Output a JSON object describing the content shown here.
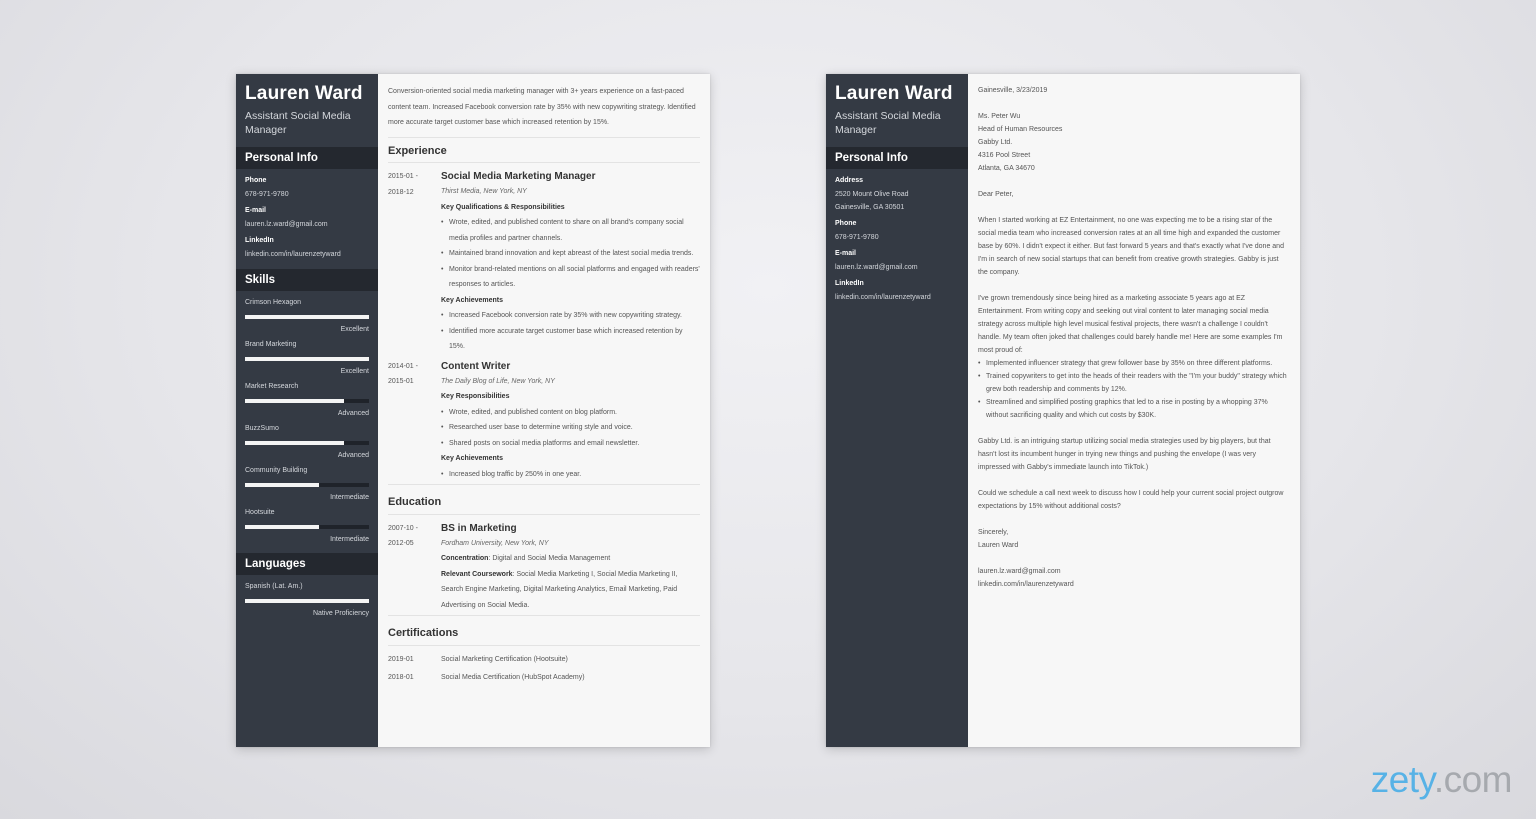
{
  "resume": {
    "name": "Lauren Ward",
    "role": "Assistant Social Media Manager",
    "personal_info_heading": "Personal Info",
    "personal_info": [
      {
        "label": "Phone",
        "value": "678-971-9780"
      },
      {
        "label": "E-mail",
        "value": "lauren.lz.ward@gmail.com"
      },
      {
        "label": "LinkedIn",
        "value": "linkedin.com/in/laurenzetyward"
      }
    ],
    "skills_heading": "Skills",
    "skills": [
      {
        "name": "Crimson Hexagon",
        "level": "Excellent",
        "fill": 1.0
      },
      {
        "name": "Brand Marketing",
        "level": "Excellent",
        "fill": 1.0
      },
      {
        "name": "Market Research",
        "level": "Advanced",
        "fill": 0.8
      },
      {
        "name": "BuzzSumo",
        "level": "Advanced",
        "fill": 0.8
      },
      {
        "name": "Community Building",
        "level": "Intermediate",
        "fill": 0.6
      },
      {
        "name": "Hootsuite",
        "level": "Intermediate",
        "fill": 0.6
      }
    ],
    "languages_heading": "Languages",
    "languages": [
      {
        "name": "Spanish (Lat. Am.)",
        "level": "Native Proficiency",
        "fill": 1.0
      }
    ],
    "summary": "Conversion-oriented social media marketing manager with 3+ years experience on a fast-paced content team. Increased Facebook conversion rate by 35% with new copywriting strategy. Identified more accurate target customer base which increased retention by 15%.",
    "experience_heading": "Experience",
    "experience": [
      {
        "start": "2015-01 -",
        "end": "2018-12",
        "title": "Social Media Marketing Manager",
        "org": "Thirst Media, New York, NY",
        "resp_heading": "Key Qualifications & Responsibilities",
        "responsibilities": [
          "Wrote, edited, and published content to share on all brand's company social media profiles and partner channels.",
          "Maintained brand innovation and kept abreast of the latest social media trends.",
          "Monitor brand-related mentions on all social platforms and engaged with readers' responses to articles."
        ],
        "ach_heading": "Key Achievements",
        "achievements": [
          "Increased Facebook conversion rate by 35% with new copywriting strategy.",
          "Identified more accurate target customer base which increased retention by 15%."
        ]
      },
      {
        "start": "2014-01 -",
        "end": "2015-01",
        "title": "Content Writer",
        "org": "The Daily Blog of Life, New York, NY",
        "resp_heading": "Key Responsibilities",
        "responsibilities": [
          "Wrote, edited, and published content on blog platform.",
          "Researched user base to determine writing style and voice.",
          "Shared posts on social media platforms and email newsletter."
        ],
        "ach_heading": "Key Achievements",
        "achievements": [
          "Increased blog traffic by 250% in one year."
        ]
      }
    ],
    "education_heading": "Education",
    "education": {
      "start": "2007-10 -",
      "end": "2012-05",
      "title": "BS in Marketing",
      "org": "Fordham University, New York, NY",
      "concentration_label": "Concentration",
      "concentration": ": Digital and Social Media Management",
      "coursework_label": "Relevant Coursework",
      "coursework": ": Social Media Marketing I, Social Media Marketing II, Search Engine Marketing, Digital Marketing Analytics, Email Marketing, Paid Advertising on Social Media."
    },
    "certifications_heading": "Certifications",
    "certifications": [
      {
        "date": "2019-01",
        "name": "Social Marketing Certification (Hootsuite)"
      },
      {
        "date": "2018-01",
        "name": "Social Media Certification (HubSpot Academy)"
      }
    ]
  },
  "letter": {
    "name": "Lauren Ward",
    "role": "Assistant Social Media Manager",
    "personal_info_heading": "Personal Info",
    "address_label": "Address",
    "address_line1": "2520 Mount Olive Road",
    "address_line2": "Gainesville, GA 30501",
    "phone_label": "Phone",
    "phone": "678-971-9780",
    "email_label": "E-mail",
    "email": "lauren.lz.ward@gmail.com",
    "linkedin_label": "LinkedIn",
    "linkedin": "linkedin.com/in/laurenzetyward",
    "place_date": "Gainesville, 3/23/2019",
    "recipient": [
      "Ms. Peter Wu",
      "Head of Human Resources",
      "Gabby Ltd.",
      "4316 Pool Street",
      "Atlanta, GA 34670"
    ],
    "greeting": "Dear Peter,",
    "para1": "When I started working at EZ Entertainment, no one was expecting me to be a rising star of the social media team who increased conversion rates at an all time high and expanded the customer base by 60%. I didn't expect it either. But fast forward 5 years and that's exactly what I've done and I'm in search of new social startups that can benefit from creative growth strategies. Gabby is just the company.",
    "para2": "I've grown tremendously since being hired as a marketing associate 5 years ago at EZ Entertainment. From writing copy and seeking out viral content to later managing social media strategy across multiple high level musical festival projects, there wasn't a challenge I couldn't handle. My team often joked that challenges could barely handle me! Here are some examples I'm most proud of:",
    "bullets": [
      "Implemented influencer strategy that grew follower base by 35% on three different platforms.",
      "Trained copywriters to get into the heads of their readers with the \"I'm your buddy\" strategy which grew both readership and comments by 12%.",
      "Streamlined and simplified posting graphics that led to a rise in posting by a whopping 37% without sacrificing quality and which cut costs by $30K."
    ],
    "para3": "Gabby Ltd. is an intriguing startup utilizing social media strategies used by big players, but that hasn't lost its incumbent hunger in trying new things and pushing the envelope (I was very impressed with Gabby's immediate launch into TikTok.)",
    "para4": "Could we schedule a call next week to discuss how I could help your current social project outgrow expectations by 15% without additional costs?",
    "closing": "Sincerely,",
    "signature": "Lauren Ward",
    "footer_email": "lauren.lz.ward@gmail.com",
    "footer_linkedin": "linkedin.com/in/laurenzetyward"
  },
  "brand": {
    "part1": "zety",
    "part2": ".com"
  }
}
